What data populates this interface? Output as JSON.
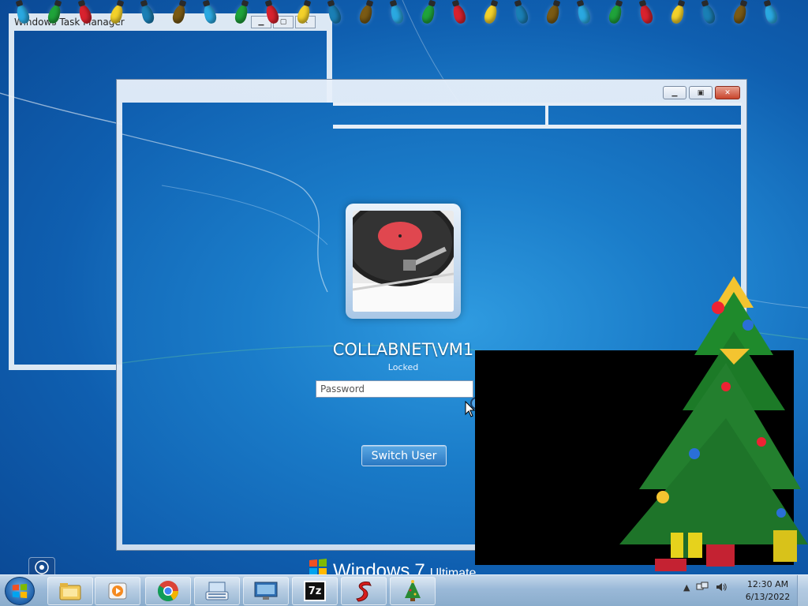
{
  "task_manager": {
    "title": "Windows Task Manager"
  },
  "login": {
    "username": "COLLABNET\\VM1",
    "status": "Locked",
    "password_placeholder": "Password",
    "switch_user_label": "Switch User"
  },
  "branding": {
    "windows": "Windows",
    "version": "7",
    "edition": "Ultimate"
  },
  "taskbar": {
    "items": [
      {
        "name": "explorer",
        "icon": "folder-icon"
      },
      {
        "name": "media",
        "icon": "media-player-icon"
      },
      {
        "name": "chrome",
        "icon": "chrome-icon"
      },
      {
        "name": "keyboard",
        "icon": "on-screen-keyboard-icon"
      },
      {
        "name": "desktop-viewer",
        "icon": "monitor-icon"
      },
      {
        "name": "7zip",
        "icon": "7zip-icon"
      },
      {
        "name": "slickedit",
        "icon": "s-app-icon"
      },
      {
        "name": "christmas-tree",
        "icon": "tree-icon"
      }
    ],
    "seven_zip_label": "7z"
  },
  "clock": {
    "time": "12:30 AM",
    "date": "6/13/2022"
  },
  "colors": {
    "desktop": "#1f84d0",
    "taskbar": "#9ab9d8",
    "close_button": "#c8442c"
  }
}
